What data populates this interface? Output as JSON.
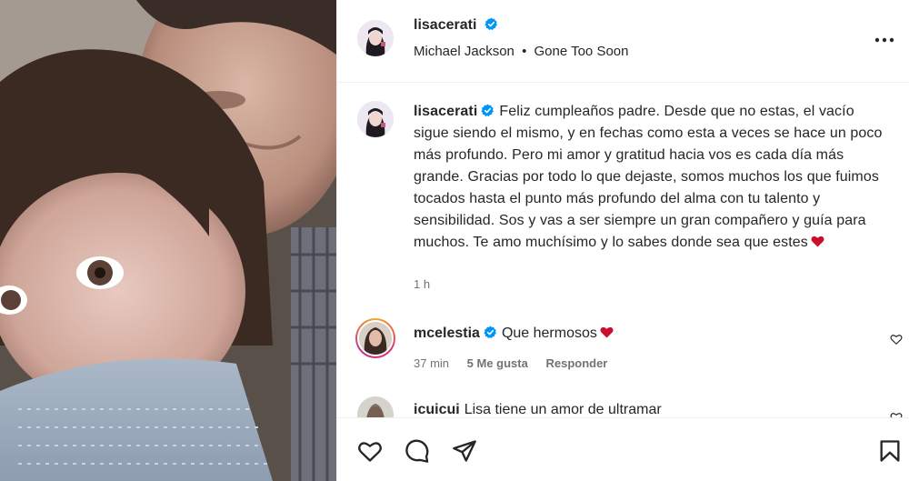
{
  "post": {
    "username": "lisacerati",
    "location_song": "Michael Jackson",
    "separator": "•",
    "song_title": "Gone Too Soon",
    "more_icon": "more-horizontal-icon"
  },
  "caption": {
    "username": "lisacerati",
    "text": "Feliz cumpleaños padre. Desde que no estas, el vacío sigue siendo el mismo, y en fechas como esta a veces se hace un poco más profundo. Pero mi amor y gratitud hacia vos es cada día más grande. Gracias por todo lo que dejaste, somos muchos los que fuimos tocados hasta el punto más profundo del alma con tu talento y sensibilidad. Sos y vas a ser siempre un gran compañero y guía para muchos. Te amo muchísimo y lo sabes donde sea que estes",
    "time": "1 h"
  },
  "comments": [
    {
      "username": "mcelestia",
      "text": "Que hermosos",
      "time": "37 min",
      "likes": "5 Me gusta",
      "reply": "Responder"
    },
    {
      "username": "icuicui",
      "text": "Lisa tiene un amor de ultramar"
    }
  ],
  "actions": {
    "like_icon": "heart-icon",
    "comment_icon": "comment-icon",
    "share_icon": "share-icon",
    "save_icon": "bookmark-icon"
  },
  "colors": {
    "verified": "#0095f6",
    "heart": "#c8102e",
    "text": "#262626",
    "muted": "#737373"
  }
}
